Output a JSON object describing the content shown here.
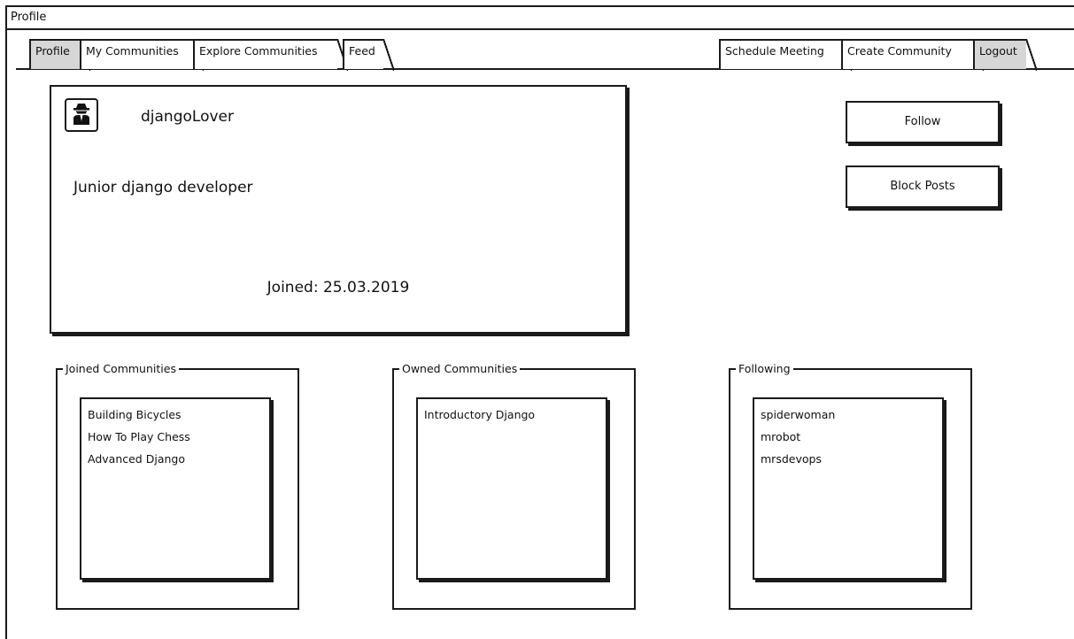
{
  "window": {
    "title": "Profile"
  },
  "tabs_left": [
    {
      "label": "Profile"
    },
    {
      "label": "My Communities"
    },
    {
      "label": "Explore Communities"
    },
    {
      "label": "Feed"
    }
  ],
  "tabs_right": [
    {
      "label": "Schedule Meeting"
    },
    {
      "label": "Create Community"
    },
    {
      "label": "Logout"
    }
  ],
  "profile": {
    "avatar_icon": "spy-icon",
    "username": "djangoLover",
    "bio": "Junior django developer",
    "joined": "Joined: 25.03.2019"
  },
  "actions": {
    "follow_label": "Follow",
    "block_label": "Block Posts"
  },
  "groups": {
    "joined": {
      "title": "Joined Communities",
      "items": [
        "Building Bicycles",
        "How To Play Chess",
        "Advanced Django"
      ]
    },
    "owned": {
      "title": "Owned Communities",
      "items": [
        "Introductory Django"
      ]
    },
    "following": {
      "title": "Following",
      "items": [
        "spiderwoman",
        "mrobot",
        "mrsdevops"
      ]
    }
  }
}
